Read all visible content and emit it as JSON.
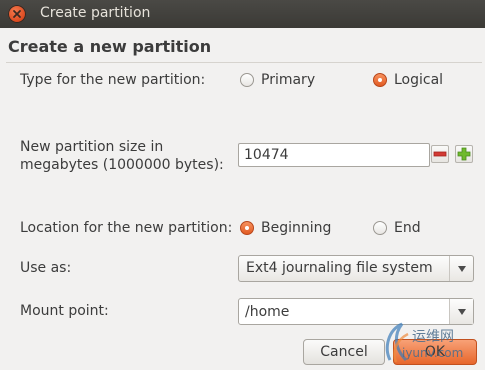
{
  "window": {
    "title": "Create partition",
    "close_icon": "close-icon"
  },
  "dialog": {
    "heading": "Create a new partition"
  },
  "form": {
    "type_label": "Type for the new partition:",
    "type_options": [
      "Primary",
      "Logical"
    ],
    "type_selected": "Logical",
    "size_label_line1": "New partition size in",
    "size_label_line2": "megabytes (1000000 bytes):",
    "size_value": "10474",
    "location_label": "Location for the new partition:",
    "location_options": [
      "Beginning",
      "End"
    ],
    "location_selected": "Beginning",
    "use_as_label": "Use as:",
    "use_as_value": "Ext4 journaling file system",
    "mount_label": "Mount point:",
    "mount_value": "/home"
  },
  "buttons": {
    "cancel": "Cancel",
    "ok": "OK"
  },
  "watermark": {
    "cn": "运维网",
    "en": "iyunv.com"
  },
  "colors": {
    "accent": "#e25b22",
    "titlebar": "#3b3a36",
    "background": "#f2f1f0"
  }
}
